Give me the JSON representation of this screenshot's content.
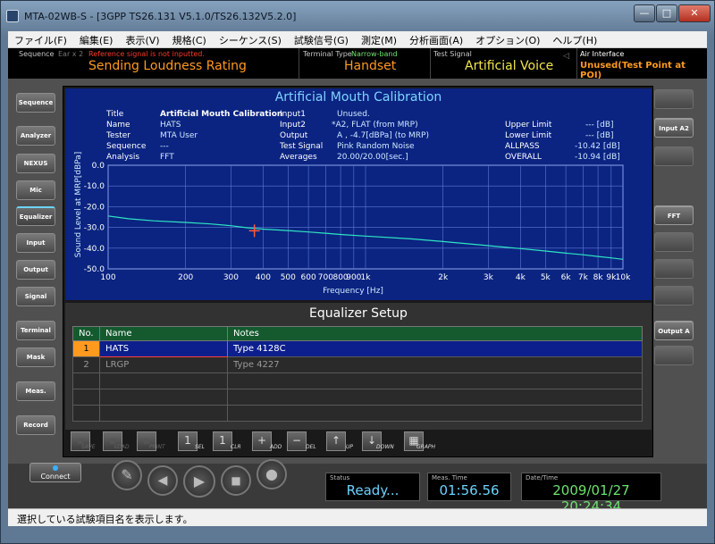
{
  "window": {
    "title": "MTA-02WB-S - [3GPP TS26.131 V5.1.0/TS26.132V5.2.0]",
    "min": "—",
    "max": "□",
    "close": "✕"
  },
  "menu": [
    "ファイル(F)",
    "編集(E)",
    "表示(V)",
    "規格(C)",
    "シーケンス(S)",
    "試験信号(G)",
    "測定(M)",
    "分析画面(A)",
    "オプション(O)",
    "ヘルプ(H)"
  ],
  "info": {
    "sequence_label": "Sequence",
    "ear_label": "Ear x 2",
    "warning": "Reference signal is not inputted.",
    "sequence_value": "Sending Loudness Rating",
    "terminal_label": "Terminal Type",
    "terminal_band": "Narrow-band",
    "terminal_value": "Handset",
    "signal_label": "Test Signal",
    "signal_value": "Artificial Voice",
    "air_label": "Air Interface",
    "air_value": "Unused(Test Point at POI)"
  },
  "left_buttons": [
    "Sequence",
    "Analyzer",
    "NEXUS",
    "Mic",
    "Equalizer",
    "Input",
    "Output",
    "Signal",
    "Terminal",
    "Mask",
    "Meas.",
    "Record"
  ],
  "right_buttons": [
    "",
    "Input A2",
    "",
    "FFT",
    "",
    "",
    "",
    "Output A",
    ""
  ],
  "graph": {
    "title": "Artificial Mouth Calibration",
    "info": {
      "title_label": "Title",
      "title_value": "Artificial Mouth Calibration",
      "name_label": "Name",
      "name_value": "HATS",
      "tester_label": "Tester",
      "tester_value": "MTA User",
      "sequence_label": "Sequence",
      "sequence_value": "---",
      "analysis_label": "Analysis",
      "analysis_value": "FFT",
      "input1_label": "Input1",
      "input1_value": "Unused.",
      "input2_label": "Input2",
      "input2_value": "*A2, FLAT (from MRP)",
      "output_label": "Output",
      "output_value": "A , -4.7[dBPa] (to MRP)",
      "signal_label": "Test Signal",
      "signal_value": "Pink Random Noise",
      "averages_label": "Averages",
      "averages_value": "20.00/20.00[sec.]",
      "upper_label": "Upper Limit",
      "upper_value": "--- [dB]",
      "lower_label": "Lower Limit",
      "lower_value": "--- [dB]",
      "allpass_label": "ALLPASS",
      "allpass_value": "-10.42 [dB]",
      "overall_label": "OVERALL",
      "overall_value": "-10.94 [dB]"
    }
  },
  "chart_data": {
    "type": "line",
    "xlabel": "Frequency [Hz]",
    "ylabel": "Sound Level at MRP[dBPa]",
    "x_scale": "log",
    "xlim": [
      100,
      10000
    ],
    "ylim": [
      -50,
      0
    ],
    "yticks": [
      0,
      -10,
      -20,
      -30,
      -40,
      -50
    ],
    "ytick_labels": [
      "0.0",
      "-10.0",
      "-20.0",
      "-30.0",
      "-40.0",
      "-50.0"
    ],
    "xticks": [
      100,
      200,
      300,
      400,
      500,
      600,
      700,
      800,
      900,
      1000,
      2000,
      3000,
      4000,
      5000,
      6000,
      7000,
      8000,
      9000,
      10000
    ],
    "xtick_labels": [
      "100",
      "200",
      "300",
      "400",
      "500",
      "600",
      "700",
      "800",
      "900",
      "1k",
      "2k",
      "3k",
      "4k",
      "5k",
      "6k",
      "7k",
      "8k",
      "9k",
      "10k"
    ],
    "grid": true,
    "series": [
      {
        "x": [
          100,
          120,
          150,
          200,
          250,
          300,
          350,
          380,
          400,
          500,
          600,
          700,
          800,
          1000,
          1500,
          2000,
          3000,
          4000,
          5000,
          6000,
          7000,
          8000,
          9000,
          10000
        ],
        "y": [
          -24.5,
          -25.8,
          -26.8,
          -27.6,
          -28.3,
          -29.2,
          -30.2,
          -30.5,
          -30.8,
          -31.5,
          -32.2,
          -32.8,
          -33.4,
          -34.2,
          -35.5,
          -36.8,
          -38.8,
          -40.2,
          -41.4,
          -42.4,
          -43.2,
          -44,
          -44.7,
          -45.4
        ]
      }
    ],
    "cursor": {
      "x": 370,
      "y": -31.6
    }
  },
  "eq": {
    "title": "Equalizer Setup",
    "headers": [
      "No.",
      "Name",
      "Notes"
    ],
    "rows": [
      [
        "1",
        "HATS",
        "Type 4128C"
      ],
      [
        "2",
        "LRGP",
        "Type 4227"
      ],
      [
        "",
        "",
        ""
      ],
      [
        "",
        "",
        ""
      ],
      [
        "",
        "",
        ""
      ]
    ]
  },
  "toolbar": [
    "SAVE",
    "LOAD",
    "PRINT",
    "SEL",
    "CLR",
    "ADD",
    "DEL",
    "UP",
    "DOWN",
    "GRAPH"
  ],
  "bottom": {
    "connect": "Connect",
    "status_label": "Status",
    "status_value": "Ready...",
    "meas_label": "Meas. Time",
    "meas_value": "01:56.56",
    "date_label": "Date/Time",
    "date_value": "2009/01/27 20:24:34"
  },
  "statusbar": "選択している試験項目名を表示します。"
}
